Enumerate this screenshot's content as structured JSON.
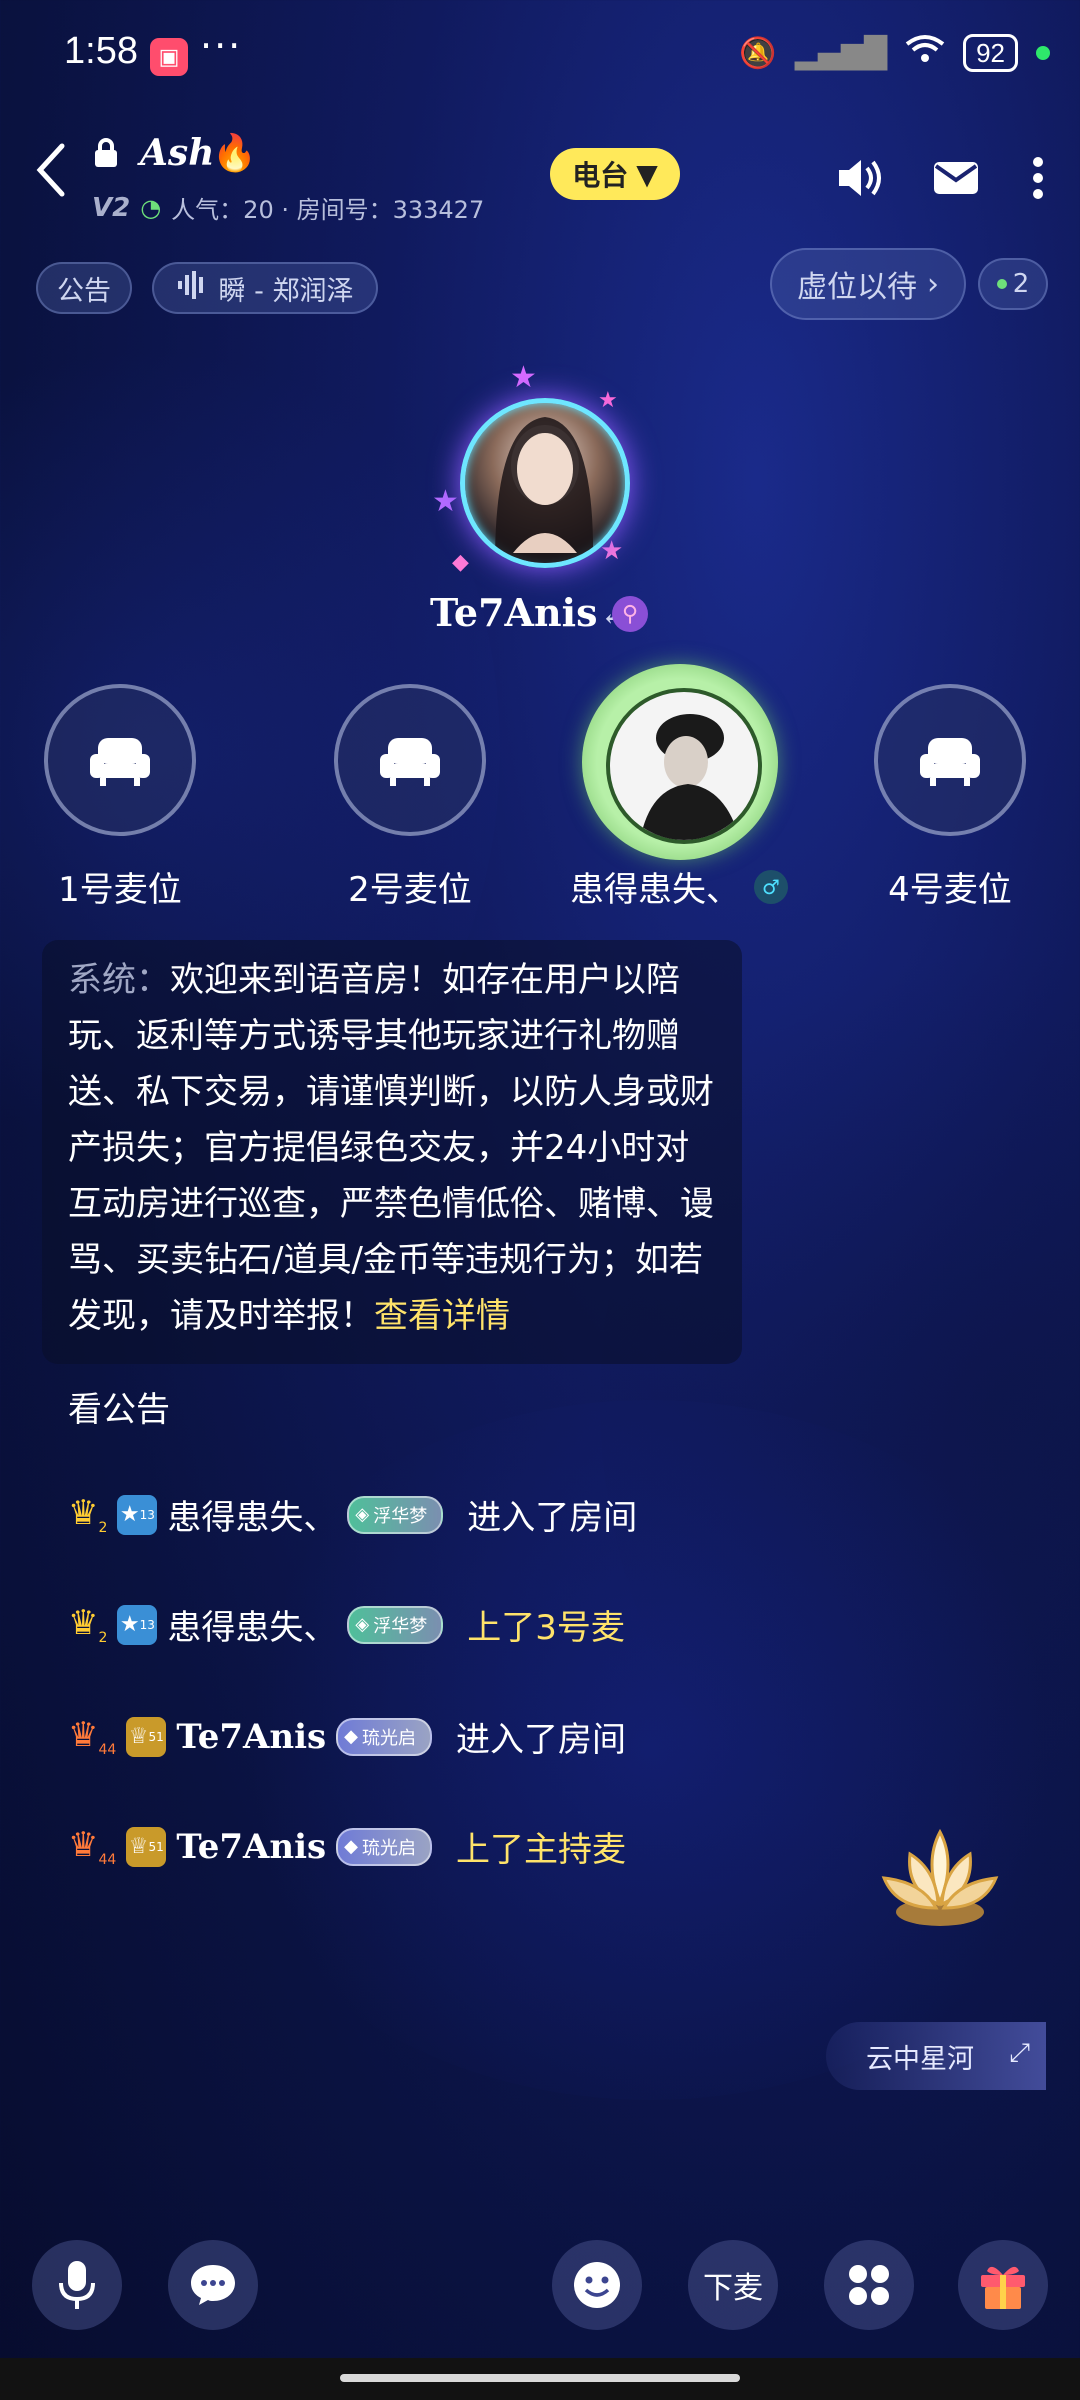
{
  "status_bar": {
    "time": "1:58",
    "dots": "···",
    "battery": "92"
  },
  "header": {
    "room_name": "Ash",
    "level": "V2",
    "popularity": "人气：20 · 房间号：333427",
    "radio_label": "电台"
  },
  "chips": {
    "announcement": "公告",
    "song": "瞬 - 郑润泽",
    "seat_wait": "虚位以待",
    "online_count": "2"
  },
  "host": {
    "name": "Te7Anis"
  },
  "seats": [
    {
      "label": "1号麦位"
    },
    {
      "label": "2号麦位"
    },
    {
      "label": "患得患失、"
    },
    {
      "label": "4号麦位"
    }
  ],
  "system_message": {
    "prefix": "系统：",
    "text": "欢迎来到语音房！如存在用户以陪玩、返利等方式诱导其他玩家进行礼物赠送、私下交易，请谨慎判断，以防人身或财产损失；官方提倡绿色交友，并24小时对互动房进行巡查，严禁色情低俗、赌博、谩骂、买卖钻石/道具/金币等违规行为；如若发现，请及时举报！",
    "link": "查看详情"
  },
  "notice_link": "看公告",
  "messages": [
    {
      "crown_level": "2",
      "badge_level": "13",
      "name": "患得患失、",
      "tag": "浮华梦",
      "action": "进入了房间",
      "highlight": false
    },
    {
      "crown_level": "2",
      "badge_level": "13",
      "name": "患得患失、",
      "tag": "浮华梦",
      "action": "上了3号麦",
      "highlight": true
    },
    {
      "crown_level": "44",
      "badge_level": "51",
      "name": "Te7Anis",
      "tag": "琉光启",
      "action": "进入了房间",
      "highlight": false
    },
    {
      "crown_level": "44",
      "badge_level": "51",
      "name": "Te7Anis",
      "tag": "琉光启",
      "action": "上了主持麦",
      "highlight": true
    }
  ],
  "floating_card": {
    "label": "云中星河"
  },
  "bottom_bar": {
    "leave_mic": "下麦"
  },
  "colors": {
    "accent_yellow": "#ffe36a",
    "seat_active_ring": "#9be08a",
    "host_ring": "#6ee6ff"
  }
}
